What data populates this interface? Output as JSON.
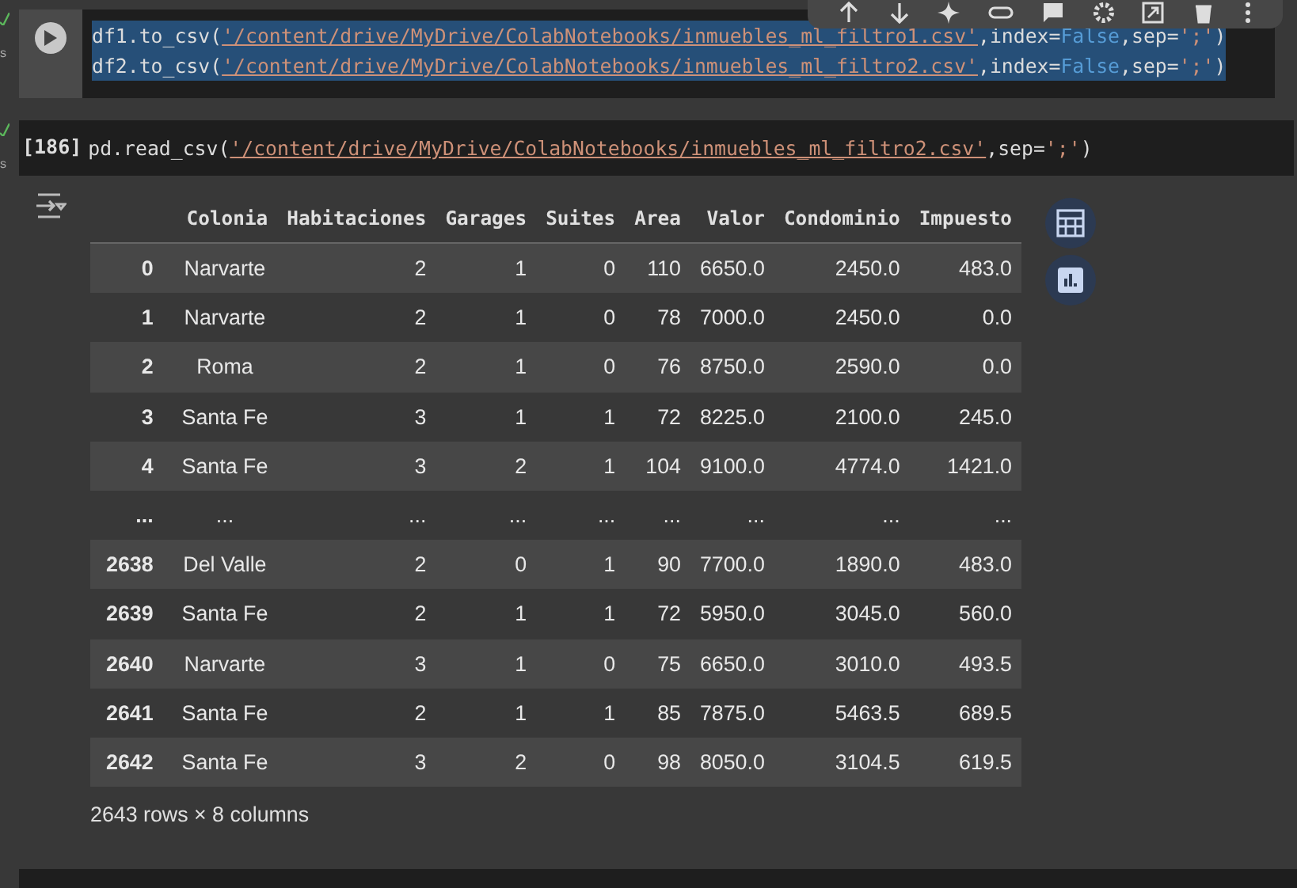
{
  "cells": [
    {
      "status": "s",
      "selected": true,
      "lines": [
        [
          {
            "kind": "plain",
            "text": "df1.to_csv("
          },
          {
            "kind": "path",
            "text": "'/content/drive/MyDrive/ColabNotebooks/inmuebles_ml_filtro1.csv'"
          },
          {
            "kind": "plain",
            "text": ",index="
          },
          {
            "kind": "keyword",
            "text": "False"
          },
          {
            "kind": "plain",
            "text": ",sep="
          },
          {
            "kind": "string",
            "text": "';'"
          },
          {
            "kind": "plain",
            "text": ")"
          }
        ],
        [
          {
            "kind": "plain",
            "text": "df2.to_csv("
          },
          {
            "kind": "path",
            "text": "'/content/drive/MyDrive/ColabNotebooks/inmuebles_ml_filtro2.csv'"
          },
          {
            "kind": "plain",
            "text": ",index="
          },
          {
            "kind": "keyword",
            "text": "False"
          },
          {
            "kind": "plain",
            "text": ",sep="
          },
          {
            "kind": "string",
            "text": "';'"
          },
          {
            "kind": "plain",
            "text": ")"
          }
        ]
      ]
    },
    {
      "prompt": "[186]",
      "status": "s",
      "selected": false,
      "lines": [
        [
          {
            "kind": "plain",
            "text": "pd.read_csv("
          },
          {
            "kind": "path",
            "text": "'/content/drive/MyDrive/ColabNotebooks/inmuebles_ml_filtro2.csv'"
          },
          {
            "kind": "plain",
            "text": ",sep="
          },
          {
            "kind": "string",
            "text": "';'"
          },
          {
            "kind": "plain",
            "text": ")"
          }
        ]
      ]
    }
  ],
  "table": {
    "columns": [
      "",
      "Colonia",
      "Habitaciones",
      "Garages",
      "Suites",
      "Area",
      "Valor",
      "Condominio",
      "Impuesto"
    ],
    "rows": [
      [
        "0",
        "Narvarte",
        "2",
        "1",
        "0",
        "110",
        "6650.0",
        "2450.0",
        "483.0"
      ],
      [
        "1",
        "Narvarte",
        "2",
        "1",
        "0",
        "78",
        "7000.0",
        "2450.0",
        "0.0"
      ],
      [
        "2",
        "Roma",
        "2",
        "1",
        "0",
        "76",
        "8750.0",
        "2590.0",
        "0.0"
      ],
      [
        "3",
        "Santa Fe",
        "3",
        "1",
        "1",
        "72",
        "8225.0",
        "2100.0",
        "245.0"
      ],
      [
        "4",
        "Santa Fe",
        "3",
        "2",
        "1",
        "104",
        "9100.0",
        "4774.0",
        "1421.0"
      ],
      [
        "...",
        "...",
        "...",
        "...",
        "...",
        "...",
        "...",
        "...",
        "..."
      ],
      [
        "2638",
        "Del Valle",
        "2",
        "0",
        "1",
        "90",
        "7700.0",
        "1890.0",
        "483.0"
      ],
      [
        "2639",
        "Santa Fe",
        "2",
        "1",
        "1",
        "72",
        "5950.0",
        "3045.0",
        "560.0"
      ],
      [
        "2640",
        "Narvarte",
        "3",
        "1",
        "0",
        "75",
        "6650.0",
        "3010.0",
        "493.5"
      ],
      [
        "2641",
        "Santa Fe",
        "2",
        "1",
        "1",
        "85",
        "7875.0",
        "5463.5",
        "689.5"
      ],
      [
        "2642",
        "Santa Fe",
        "3",
        "2",
        "0",
        "98",
        "8050.0",
        "3104.5",
        "619.5"
      ]
    ],
    "footer": "2643 rows × 8 columns"
  }
}
